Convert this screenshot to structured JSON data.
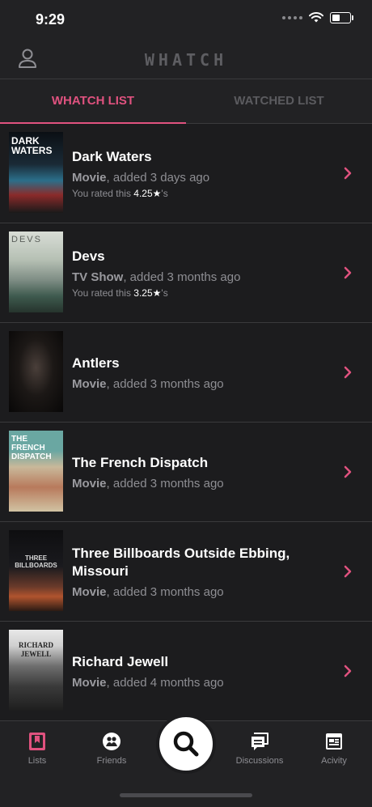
{
  "status": {
    "time": "9:29"
  },
  "header": {
    "logo": "WHATCH"
  },
  "tabs": [
    {
      "label": "WHATCH LIST",
      "active": true
    },
    {
      "label": "WATCHED LIST",
      "active": false
    }
  ],
  "items": [
    {
      "poster_text": "DARK WATERS",
      "title": "Dark Waters",
      "type": "Movie",
      "added": ", added 3 days ago",
      "rated_prefix": "You rated this ",
      "rating": "4.25★",
      "rated_suffix": "'s"
    },
    {
      "poster_text": "DEVS",
      "title": "Devs",
      "type": "TV Show",
      "added": ", added 3 months ago",
      "rated_prefix": "You rated this ",
      "rating": "3.25★",
      "rated_suffix": "'s"
    },
    {
      "poster_text": "",
      "title": "Antlers",
      "type": "Movie",
      "added": ", added 3 months ago"
    },
    {
      "poster_text": "THE FRENCH DISPATCH",
      "title": "The French Dispatch",
      "type": "Movie",
      "added": ", added 3 months ago"
    },
    {
      "poster_text": "THREE BILLBOARDS",
      "title": "Three Billboards Outside Ebbing, Missouri",
      "type": "Movie",
      "added": ", added 3 months ago"
    },
    {
      "poster_text": "RICHARD JEWELL",
      "title": "Richard Jewell",
      "type": "Movie",
      "added": ", added 4 months ago"
    }
  ],
  "tabbar": {
    "lists": "Lists",
    "friends": "Friends",
    "discussions": "Discussions",
    "activity": "Acivity"
  },
  "colors": {
    "accent": "#e0527f",
    "background": "#1c1c1e"
  }
}
